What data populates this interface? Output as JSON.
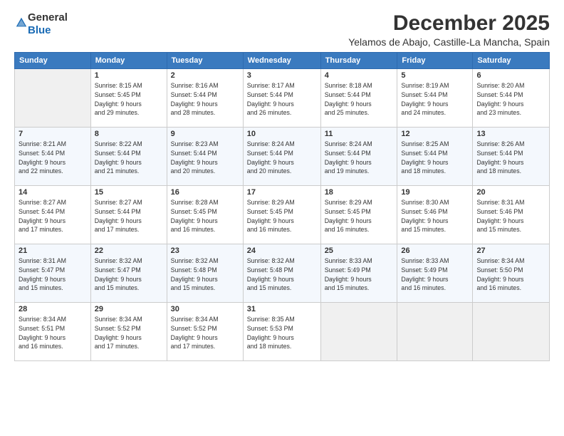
{
  "logo": {
    "general": "General",
    "blue": "Blue"
  },
  "header": {
    "month": "December 2025",
    "location": "Yelamos de Abajo, Castille-La Mancha, Spain"
  },
  "days_of_week": [
    "Sunday",
    "Monday",
    "Tuesday",
    "Wednesday",
    "Thursday",
    "Friday",
    "Saturday"
  ],
  "weeks": [
    [
      {
        "num": "",
        "info": ""
      },
      {
        "num": "1",
        "info": "Sunrise: 8:15 AM\nSunset: 5:45 PM\nDaylight: 9 hours\nand 29 minutes."
      },
      {
        "num": "2",
        "info": "Sunrise: 8:16 AM\nSunset: 5:44 PM\nDaylight: 9 hours\nand 28 minutes."
      },
      {
        "num": "3",
        "info": "Sunrise: 8:17 AM\nSunset: 5:44 PM\nDaylight: 9 hours\nand 26 minutes."
      },
      {
        "num": "4",
        "info": "Sunrise: 8:18 AM\nSunset: 5:44 PM\nDaylight: 9 hours\nand 25 minutes."
      },
      {
        "num": "5",
        "info": "Sunrise: 8:19 AM\nSunset: 5:44 PM\nDaylight: 9 hours\nand 24 minutes."
      },
      {
        "num": "6",
        "info": "Sunrise: 8:20 AM\nSunset: 5:44 PM\nDaylight: 9 hours\nand 23 minutes."
      }
    ],
    [
      {
        "num": "7",
        "info": "Sunrise: 8:21 AM\nSunset: 5:44 PM\nDaylight: 9 hours\nand 22 minutes."
      },
      {
        "num": "8",
        "info": "Sunrise: 8:22 AM\nSunset: 5:44 PM\nDaylight: 9 hours\nand 21 minutes."
      },
      {
        "num": "9",
        "info": "Sunrise: 8:23 AM\nSunset: 5:44 PM\nDaylight: 9 hours\nand 20 minutes."
      },
      {
        "num": "10",
        "info": "Sunrise: 8:24 AM\nSunset: 5:44 PM\nDaylight: 9 hours\nand 20 minutes."
      },
      {
        "num": "11",
        "info": "Sunrise: 8:24 AM\nSunset: 5:44 PM\nDaylight: 9 hours\nand 19 minutes."
      },
      {
        "num": "12",
        "info": "Sunrise: 8:25 AM\nSunset: 5:44 PM\nDaylight: 9 hours\nand 18 minutes."
      },
      {
        "num": "13",
        "info": "Sunrise: 8:26 AM\nSunset: 5:44 PM\nDaylight: 9 hours\nand 18 minutes."
      }
    ],
    [
      {
        "num": "14",
        "info": "Sunrise: 8:27 AM\nSunset: 5:44 PM\nDaylight: 9 hours\nand 17 minutes."
      },
      {
        "num": "15",
        "info": "Sunrise: 8:27 AM\nSunset: 5:44 PM\nDaylight: 9 hours\nand 17 minutes."
      },
      {
        "num": "16",
        "info": "Sunrise: 8:28 AM\nSunset: 5:45 PM\nDaylight: 9 hours\nand 16 minutes."
      },
      {
        "num": "17",
        "info": "Sunrise: 8:29 AM\nSunset: 5:45 PM\nDaylight: 9 hours\nand 16 minutes."
      },
      {
        "num": "18",
        "info": "Sunrise: 8:29 AM\nSunset: 5:45 PM\nDaylight: 9 hours\nand 16 minutes."
      },
      {
        "num": "19",
        "info": "Sunrise: 8:30 AM\nSunset: 5:46 PM\nDaylight: 9 hours\nand 15 minutes."
      },
      {
        "num": "20",
        "info": "Sunrise: 8:31 AM\nSunset: 5:46 PM\nDaylight: 9 hours\nand 15 minutes."
      }
    ],
    [
      {
        "num": "21",
        "info": "Sunrise: 8:31 AM\nSunset: 5:47 PM\nDaylight: 9 hours\nand 15 minutes."
      },
      {
        "num": "22",
        "info": "Sunrise: 8:32 AM\nSunset: 5:47 PM\nDaylight: 9 hours\nand 15 minutes."
      },
      {
        "num": "23",
        "info": "Sunrise: 8:32 AM\nSunset: 5:48 PM\nDaylight: 9 hours\nand 15 minutes."
      },
      {
        "num": "24",
        "info": "Sunrise: 8:32 AM\nSunset: 5:48 PM\nDaylight: 9 hours\nand 15 minutes."
      },
      {
        "num": "25",
        "info": "Sunrise: 8:33 AM\nSunset: 5:49 PM\nDaylight: 9 hours\nand 15 minutes."
      },
      {
        "num": "26",
        "info": "Sunrise: 8:33 AM\nSunset: 5:49 PM\nDaylight: 9 hours\nand 16 minutes."
      },
      {
        "num": "27",
        "info": "Sunrise: 8:34 AM\nSunset: 5:50 PM\nDaylight: 9 hours\nand 16 minutes."
      }
    ],
    [
      {
        "num": "28",
        "info": "Sunrise: 8:34 AM\nSunset: 5:51 PM\nDaylight: 9 hours\nand 16 minutes."
      },
      {
        "num": "29",
        "info": "Sunrise: 8:34 AM\nSunset: 5:52 PM\nDaylight: 9 hours\nand 17 minutes."
      },
      {
        "num": "30",
        "info": "Sunrise: 8:34 AM\nSunset: 5:52 PM\nDaylight: 9 hours\nand 17 minutes."
      },
      {
        "num": "31",
        "info": "Sunrise: 8:35 AM\nSunset: 5:53 PM\nDaylight: 9 hours\nand 18 minutes."
      },
      {
        "num": "",
        "info": ""
      },
      {
        "num": "",
        "info": ""
      },
      {
        "num": "",
        "info": ""
      }
    ]
  ]
}
